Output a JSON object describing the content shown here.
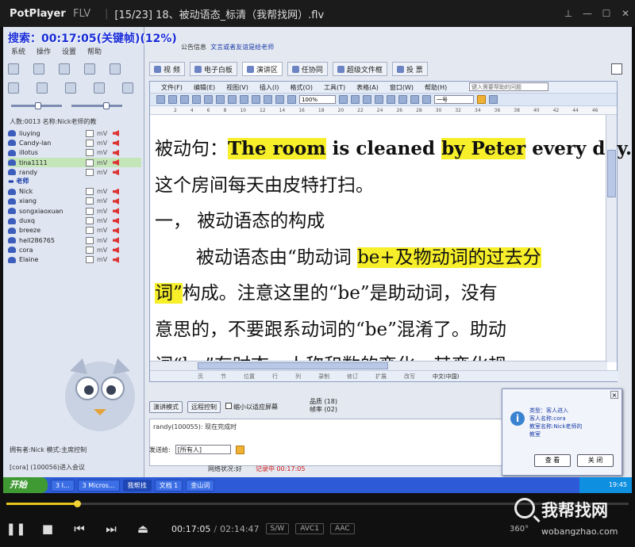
{
  "titlebar": {
    "app": "PotPlayer",
    "format": "FLV",
    "title": "[15/23] 18、被动语态_标清（我帮找网）.flv"
  },
  "overlay": {
    "search_text": "搜索：00:17:05(关键帧)(12%)"
  },
  "client": {
    "menu": [
      "系统",
      "操作",
      "设置",
      "帮助"
    ],
    "count_line": "人数:0013  名称:Nick老师的教",
    "users": [
      {
        "name": "liuying",
        "status": "mV"
      },
      {
        "name": "Candy-lan",
        "status": "mV"
      },
      {
        "name": "illotus",
        "status": "mV"
      },
      {
        "name": "tina1111",
        "status": "mV",
        "selected": true
      },
      {
        "name": "randy",
        "status": "mV"
      }
    ],
    "group_teacher": "老师",
    "teachers": [
      {
        "name": "Nick",
        "status": "mV"
      },
      {
        "name": "xiang",
        "status": "mV"
      },
      {
        "name": "songxiaoxuan",
        "status": "mV"
      },
      {
        "name": "duxq",
        "status": "mV"
      },
      {
        "name": "breeze",
        "status": "mV"
      },
      {
        "name": "hell286765",
        "status": "mV"
      },
      {
        "name": "cora",
        "status": "mV"
      },
      {
        "name": "Elaine",
        "status": "mV"
      }
    ],
    "owner_line": "拥有者:Nick  模式:主席控制",
    "syslog": "[cora] (100056)进入会议"
  },
  "right": {
    "notice_label": "公告信息",
    "notice_text": "文言或者友谊是给老师",
    "tabs": [
      "视 频",
      "电子白板",
      "演讲区",
      "任协同",
      "超级文件框",
      "投 票"
    ],
    "doc_menu": [
      "文件(F)",
      "编辑(E)",
      "视图(V)",
      "插入(I)",
      "格式(O)",
      "工具(T)",
      "表格(A)",
      "窗口(W)",
      "帮助(H)"
    ],
    "help_placeholder": "键入需要帮助的问题",
    "zoom": "100%",
    "font": "一号",
    "ruler": [
      "2",
      "4",
      "6",
      "8",
      "10",
      "12",
      "14",
      "16",
      "18",
      "20",
      "22",
      "24",
      "26",
      "28",
      "30",
      "32",
      "34",
      "36",
      "38",
      "40",
      "42",
      "44",
      "46"
    ],
    "status_items": [
      "页",
      "节",
      "位置",
      "行",
      "列",
      "录制",
      "修订",
      "扩展",
      "改写"
    ],
    "status_lang": "中文(中国)",
    "controls": {
      "mode_btn": "演讲模式",
      "remote_btn": "远程控制",
      "fit_label": "缩小以适应屏幕"
    },
    "quality": {
      "label1": "品质",
      "val1": "(18)",
      "label2": "帧率",
      "val2": "(02)"
    },
    "chat_line": "randy(100055): 现在完成时",
    "send_label": "发送给:",
    "send_target": "[所有人]",
    "net_status": "网络状况:好",
    "rec_status": "记录中 00:17:05"
  },
  "document_text": {
    "l1": [
      "被动句：",
      "The room",
      " is cleaned ",
      "by Peter",
      " every day."
    ],
    "l2": "这个房间每天由皮特打扫。",
    "l3": "一，  被动语态的构成",
    "l4": [
      "被动语态由“助动词 ",
      "be+及物动词的过去分"
    ],
    "l5": [
      "词”",
      "构成。注意这里的“be”是助动词，没有"
    ],
    "l6": "意思的，不要跟系动词的“be”混淆了。助动",
    "l7": "词“be”有时态，人称和数的变化，其变化规"
  },
  "popup": {
    "lines": [
      "类型：客人进入",
      "客人名称:cora",
      "教室名称:Nick老师的",
      "教室"
    ],
    "btn_view": "查 看",
    "btn_close": "关 闭"
  },
  "taskbar": {
    "start": "开始",
    "tasks": [
      "3 I...",
      "3 Micros...",
      "我帮找",
      "文档 1",
      "金山词"
    ],
    "clock": "19:45"
  },
  "player": {
    "progress": 0.12,
    "time_current": "00:17:05",
    "time_sep": "/",
    "time_total": "02:14:47",
    "tags": [
      "S/W",
      "AVC1",
      "AAC"
    ]
  },
  "watermark": {
    "main": "我帮找网",
    "url": "wobangzhao.com",
    "deg": "360°"
  }
}
